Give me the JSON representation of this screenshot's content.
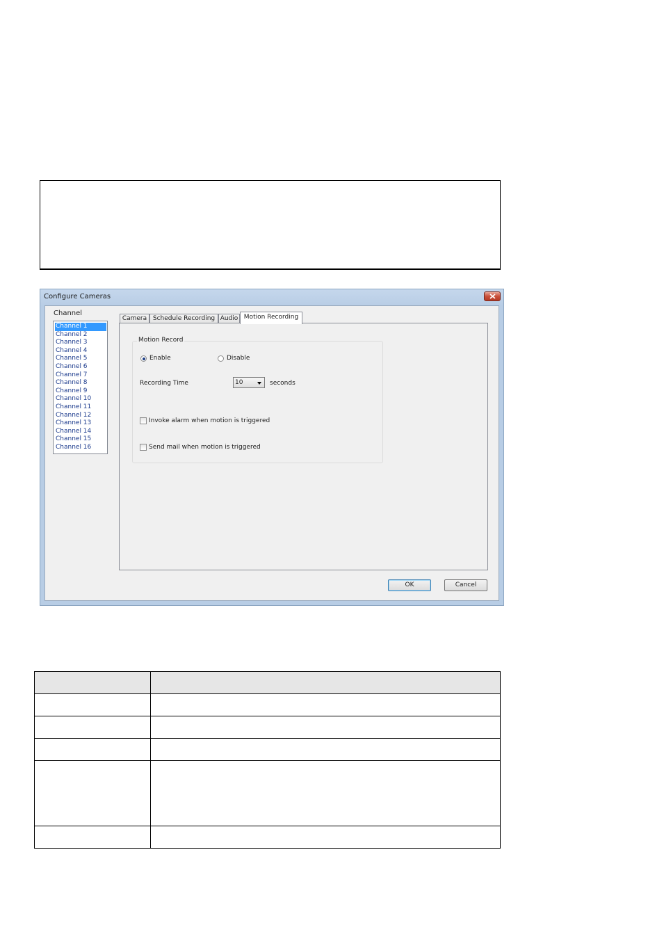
{
  "dialog": {
    "title": "Configure Cameras",
    "channel_label": "Channel",
    "channels": [
      "Channel 1",
      "Channel 2",
      "Channel 3",
      "Channel 4",
      "Channel 5",
      "Channel 6",
      "Channel 7",
      "Channel 8",
      "Channel 9",
      "Channel 10",
      "Channel 11",
      "Channel 12",
      "Channel 13",
      "Channel 14",
      "Channel 15",
      "Channel 16"
    ],
    "selected_channel": "Channel 1",
    "tabs": [
      "Camera",
      "Schedule Recording",
      "Audio",
      "Motion Recording"
    ],
    "active_tab": "Motion Recording",
    "motion": {
      "group_title": "Motion Record",
      "enable_label": "Enable",
      "disable_label": "Disable",
      "enabled": true,
      "recording_time_label": "Recording Time",
      "recording_time_value": "10",
      "seconds_label": "seconds",
      "invoke_alarm_label": "Invoke alarm when motion is triggered",
      "send_mail_label": "Send mail when motion is triggered"
    },
    "ok_label": "OK",
    "cancel_label": "Cancel"
  }
}
